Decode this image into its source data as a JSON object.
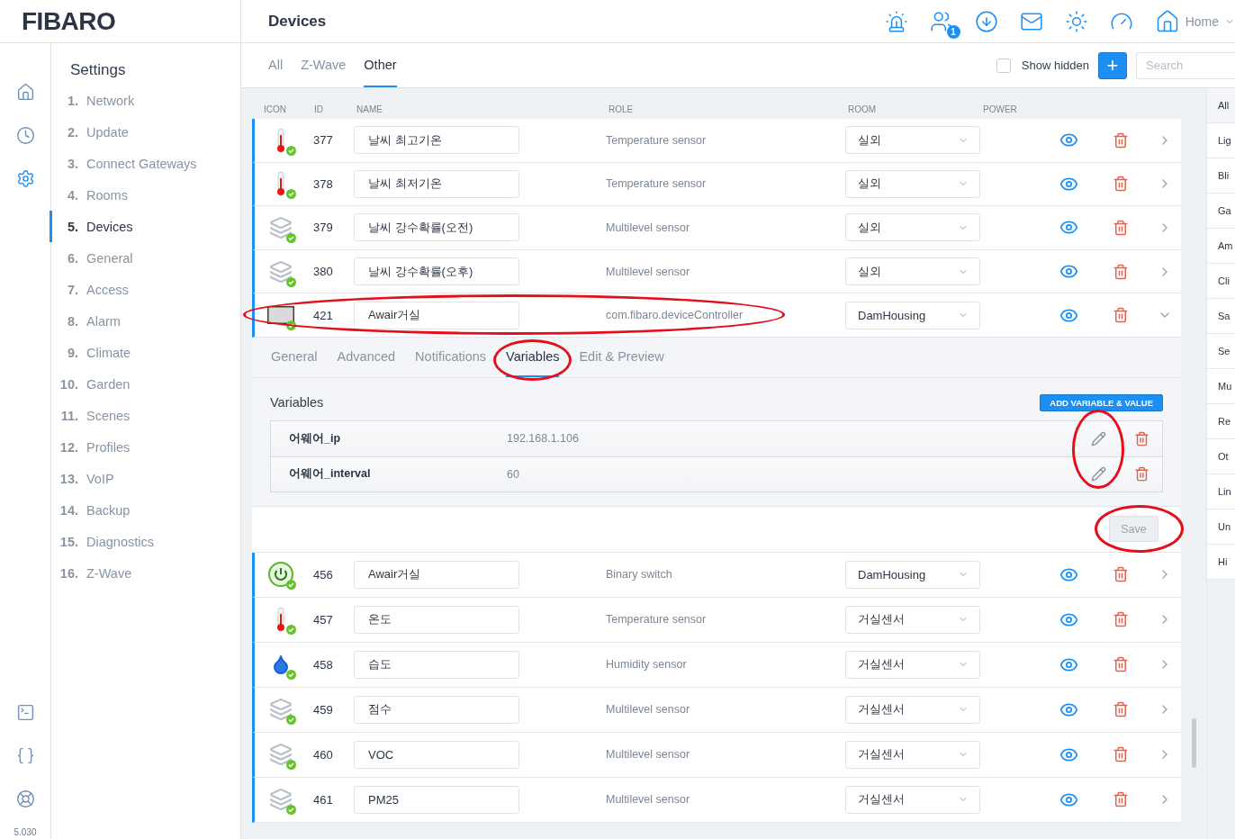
{
  "logo": "FIBARO",
  "rail": {
    "top": [
      {
        "kind": "home",
        "selected": false
      },
      {
        "kind": "clock",
        "selected": false
      },
      {
        "kind": "gear",
        "selected": true
      }
    ],
    "bottom": [
      {
        "kind": "terminal"
      },
      {
        "kind": "braces"
      },
      {
        "kind": "lifebuoy"
      }
    ],
    "version": "5.030"
  },
  "settings": {
    "title": "Settings",
    "items": [
      {
        "number": "1.",
        "label": "Network",
        "selected": false
      },
      {
        "number": "2.",
        "label": "Update",
        "selected": false
      },
      {
        "number": "3.",
        "label": "Connect Gateways",
        "selected": false
      },
      {
        "number": "4.",
        "label": "Rooms",
        "selected": false
      },
      {
        "number": "5.",
        "label": "Devices",
        "selected": true
      },
      {
        "number": "6.",
        "label": "General",
        "selected": false
      },
      {
        "number": "7.",
        "label": "Access",
        "selected": false
      },
      {
        "number": "8.",
        "label": "Alarm",
        "selected": false
      },
      {
        "number": "9.",
        "label": "Climate",
        "selected": false
      },
      {
        "number": "10.",
        "label": "Garden",
        "selected": false
      },
      {
        "number": "11.",
        "label": "Scenes",
        "selected": false
      },
      {
        "number": "12.",
        "label": "Profiles",
        "selected": false
      },
      {
        "number": "13.",
        "label": "VoIP",
        "selected": false
      },
      {
        "number": "14.",
        "label": "Backup",
        "selected": false
      },
      {
        "number": "15.",
        "label": "Diagnostics",
        "selected": false
      },
      {
        "number": "16.",
        "label": "Z-Wave",
        "selected": false
      }
    ]
  },
  "header": {
    "title": "Devices",
    "icons": [
      {
        "kind": "siren"
      },
      {
        "kind": "users",
        "badge": "1"
      },
      {
        "kind": "download"
      },
      {
        "kind": "mail"
      },
      {
        "kind": "sun"
      },
      {
        "kind": "gauge"
      }
    ],
    "location": "Home"
  },
  "filter_tabs": [
    {
      "label": "All",
      "selected": false
    },
    {
      "label": "Z-Wave",
      "selected": false
    },
    {
      "label": "Other",
      "selected": true
    }
  ],
  "show_hidden": {
    "label": "Show hidden",
    "checked": false
  },
  "add_button": "+",
  "search": {
    "placeholder": "Search"
  },
  "columns": [
    "ICON",
    "ID",
    "NAME",
    "ROLE",
    "ROOM",
    "POWER"
  ],
  "devices": [
    {
      "kind": "thermometer",
      "id": "377",
      "name": "날씨 최고기온",
      "role": "Temperature sensor",
      "room": "실외",
      "expanded": false,
      "circled": false
    },
    {
      "kind": "thermometer",
      "id": "378",
      "name": "날씨 최저기온",
      "role": "Temperature sensor",
      "room": "실외",
      "expanded": false,
      "circled": false
    },
    {
      "kind": "stack",
      "id": "379",
      "name": "날씨 강수확률(오전)",
      "role": "Multilevel sensor",
      "room": "실외",
      "expanded": false,
      "circled": false
    },
    {
      "kind": "stack",
      "id": "380",
      "name": "날씨 강수확률(오후)",
      "role": "Multilevel sensor",
      "room": "실외",
      "expanded": false,
      "circled": false
    },
    {
      "kind": "controller",
      "id": "421",
      "name": "Awair거실",
      "role": "com.fibaro.deviceController",
      "room": "DamHousing",
      "expanded": true,
      "circled": true
    },
    {
      "kind": "power",
      "id": "456",
      "name": "Awair거실",
      "role": "Binary switch",
      "room": "DamHousing",
      "expanded": false,
      "circled": false
    },
    {
      "kind": "thermometer",
      "id": "457",
      "name": "온도",
      "role": "Temperature sensor",
      "room": "거실센서",
      "expanded": false,
      "circled": false
    },
    {
      "kind": "drop",
      "id": "458",
      "name": "습도",
      "role": "Humidity sensor",
      "room": "거실센서",
      "expanded": false,
      "circled": false
    },
    {
      "kind": "stack",
      "id": "459",
      "name": "점수",
      "role": "Multilevel sensor",
      "room": "거실센서",
      "expanded": false,
      "circled": false
    },
    {
      "kind": "stack",
      "id": "460",
      "name": "VOC",
      "role": "Multilevel sensor",
      "room": "거실센서",
      "expanded": false,
      "circled": false
    },
    {
      "kind": "stack",
      "id": "461",
      "name": "PM25",
      "role": "Multilevel sensor",
      "room": "거실센서",
      "expanded": false,
      "circled": false
    }
  ],
  "detail": {
    "tabs": [
      {
        "label": "General",
        "selected": false,
        "circled": false
      },
      {
        "label": "Advanced",
        "selected": false,
        "circled": false
      },
      {
        "label": "Notifications",
        "selected": false,
        "circled": false
      },
      {
        "label": "Variables",
        "selected": true,
        "circled": true
      },
      {
        "label": "Edit & Preview",
        "selected": false,
        "circled": false
      }
    ],
    "section_title": "Variables",
    "add_button": "ADD VARIABLE & VALUE",
    "variables": [
      {
        "name": "어웨어_ip",
        "value": "192.168.1.106"
      },
      {
        "name": "어웨어_interval",
        "value": "60"
      }
    ],
    "edit_circled": true,
    "save": {
      "label": "Save",
      "circled": true
    }
  },
  "categories": [
    {
      "label": "All",
      "selected": true
    },
    {
      "label": "Lig",
      "selected": false
    },
    {
      "label": "Bli",
      "selected": false
    },
    {
      "label": "Ga",
      "selected": false
    },
    {
      "label": "Am",
      "selected": false
    },
    {
      "label": "Cli",
      "selected": false
    },
    {
      "label": "Sa",
      "selected": false
    },
    {
      "label": "Se",
      "selected": false
    },
    {
      "label": "Mu",
      "selected": false
    },
    {
      "label": "Re",
      "selected": false
    },
    {
      "label": "Ot",
      "selected": false
    },
    {
      "label": "Lin",
      "selected": false
    },
    {
      "label": "Un",
      "selected": false
    },
    {
      "label": "Hi",
      "selected": false
    }
  ]
}
